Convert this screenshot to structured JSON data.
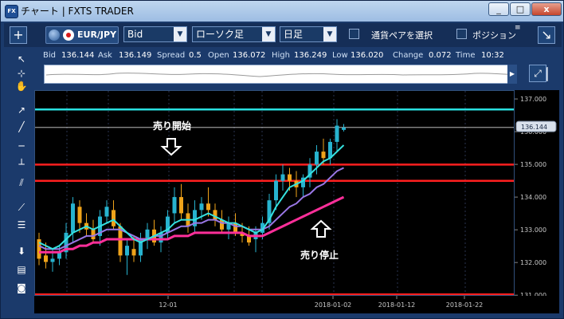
{
  "window": {
    "title": "チャート | FXTS TRADER",
    "app_icon": "FX",
    "controls": [
      "_",
      "□",
      "x"
    ]
  },
  "toolbar": {
    "add_label": "+",
    "symbol": "EUR/JPY",
    "price_type": "Bid",
    "chart_type": "ローソク足",
    "timeframe": "日足",
    "pair_select_label": "通貨ペアを選択",
    "position_label": "ポジション",
    "undock_label": "↘"
  },
  "info": {
    "bid_label": "Bid",
    "bid": "136.144",
    "ask_label": "Ask",
    "ask": "136.149",
    "spread_label": "Spread",
    "spread": "0.5",
    "open_label": "Open",
    "open": "136.072",
    "high_label": "High",
    "high": "136.249",
    "low_label": "Low",
    "low": "136.020",
    "change_label": "Change",
    "change": "0.072",
    "time_label": "Time",
    "time": "10:32"
  },
  "left_tools": [
    "cursor-icon",
    "crosshair-icon",
    "hand-icon",
    "trendline-tool-icon",
    "line-tool-icon",
    "hline-tool-icon",
    "vline-tool-icon",
    "channel-tool-icon",
    "fan-tool-icon",
    "fib-tool-icon",
    "download-icon",
    "list-icon",
    "camera-icon"
  ],
  "colors": {
    "background": "#000000",
    "panel": "#1b3a6b",
    "bull_candle": "#27b3cf",
    "bear_candle": "#f0a31a",
    "sl_line": "#ff1f1f",
    "level_line": "#29e0e0",
    "ma_fast": "#35e2e0",
    "ma_mid": "#9a77e6",
    "ma_slow": "#ff2f9a"
  },
  "annotations": {
    "sell_start": "売り開始",
    "sell_stop": "売り停止",
    "price_badge": "136.144"
  },
  "chart_data": {
    "type": "candlestick",
    "y_ticks": [
      "137.000",
      "136.000",
      "135.000",
      "134.000",
      "133.000",
      "132.000",
      "131.000"
    ],
    "x_ticks": [
      "12-01",
      "2018-01-02",
      "2018-01-12",
      "2018-01-22"
    ],
    "ylim": [
      131.0,
      137.0
    ],
    "horizontal_lines": [
      {
        "name": "cyan-level",
        "value": 136.7
      },
      {
        "name": "current-price",
        "value": 136.144
      },
      {
        "name": "red-level-1",
        "value": 135.0
      },
      {
        "name": "red-level-2",
        "value": 134.5
      },
      {
        "name": "red-level-3",
        "value": 131.0
      }
    ],
    "candles": [
      [
        132.7,
        132.9,
        131.9,
        132.1
      ],
      [
        132.2,
        132.6,
        131.8,
        132.0
      ],
      [
        132.0,
        132.4,
        131.7,
        132.1
      ],
      [
        132.1,
        132.5,
        131.9,
        132.3
      ],
      [
        132.3,
        133.2,
        132.1,
        132.9
      ],
      [
        132.9,
        134.0,
        132.6,
        133.8
      ],
      [
        133.7,
        133.9,
        132.9,
        133.2
      ],
      [
        133.2,
        133.5,
        132.8,
        133.0
      ],
      [
        133.0,
        133.3,
        132.6,
        132.7
      ],
      [
        132.8,
        133.6,
        132.5,
        133.4
      ],
      [
        133.4,
        133.9,
        133.2,
        133.7
      ],
      [
        133.6,
        133.9,
        133.0,
        133.1
      ],
      [
        133.1,
        133.2,
        132.0,
        132.2
      ],
      [
        132.2,
        132.7,
        131.6,
        132.5
      ],
      [
        132.4,
        132.8,
        132.0,
        132.2
      ],
      [
        132.2,
        132.9,
        132.0,
        132.7
      ],
      [
        132.7,
        133.2,
        132.4,
        133.0
      ],
      [
        133.0,
        133.3,
        132.5,
        132.6
      ],
      [
        132.6,
        133.1,
        132.3,
        132.9
      ],
      [
        132.9,
        133.6,
        132.7,
        133.4
      ],
      [
        133.5,
        134.3,
        133.2,
        134.0
      ],
      [
        134.0,
        134.4,
        133.3,
        133.5
      ],
      [
        133.5,
        133.8,
        132.9,
        133.1
      ],
      [
        133.1,
        133.9,
        132.9,
        133.6
      ],
      [
        133.6,
        134.0,
        133.3,
        133.8
      ],
      [
        133.8,
        134.3,
        133.4,
        133.6
      ],
      [
        133.6,
        133.8,
        133.1,
        133.3
      ],
      [
        133.3,
        133.6,
        132.9,
        133.0
      ],
      [
        133.0,
        133.4,
        132.7,
        133.2
      ],
      [
        133.2,
        133.5,
        132.8,
        132.9
      ],
      [
        132.9,
        133.2,
        132.6,
        132.8
      ],
      [
        132.8,
        133.1,
        132.5,
        132.6
      ],
      [
        132.7,
        133.1,
        132.3,
        132.9
      ],
      [
        132.9,
        133.4,
        132.7,
        133.2
      ],
      [
        133.2,
        134.1,
        133.0,
        133.9
      ],
      [
        133.9,
        134.7,
        133.6,
        134.5
      ],
      [
        134.5,
        135.0,
        134.2,
        134.7
      ],
      [
        134.7,
        134.9,
        134.2,
        134.5
      ],
      [
        134.5,
        134.8,
        134.0,
        134.3
      ],
      [
        134.3,
        134.7,
        134.0,
        134.6
      ],
      [
        134.6,
        135.2,
        134.3,
        135.0
      ],
      [
        135.0,
        135.6,
        134.7,
        135.4
      ],
      [
        135.4,
        135.8,
        135.0,
        135.2
      ],
      [
        135.2,
        135.8,
        135.0,
        135.7
      ],
      [
        135.7,
        136.4,
        135.4,
        136.2
      ],
      [
        136.07,
        136.25,
        136.02,
        136.14
      ]
    ],
    "ma_fast": [
      132.6,
      132.5,
      132.4,
      132.5,
      132.7,
      132.9,
      133.0,
      133.1,
      133.0,
      133.1,
      133.2,
      133.3,
      133.1,
      132.9,
      132.7,
      132.6,
      132.7,
      132.8,
      132.9,
      133.0,
      133.2,
      133.3,
      133.3,
      133.3,
      133.4,
      133.5,
      133.4,
      133.3,
      133.2,
      133.2,
      133.1,
      133.0,
      132.9,
      133.0,
      133.3,
      133.7,
      134.0,
      134.3,
      134.4,
      134.5,
      134.7,
      134.9,
      135.1,
      135.2,
      135.4,
      135.6
    ],
    "ma_mid": [
      132.5,
      132.4,
      132.4,
      132.4,
      132.5,
      132.6,
      132.7,
      132.8,
      132.8,
      132.9,
      133.0,
      133.0,
      133.0,
      132.9,
      132.8,
      132.7,
      132.7,
      132.8,
      132.8,
      132.9,
      133.0,
      133.1,
      133.1,
      133.2,
      133.2,
      133.3,
      133.3,
      133.2,
      133.2,
      133.1,
      133.1,
      133.0,
      133.0,
      133.0,
      133.1,
      133.3,
      133.5,
      133.7,
      133.8,
      134.0,
      134.1,
      134.3,
      134.4,
      134.6,
      134.8,
      134.9
    ],
    "ma_slow": [
      132.3,
      132.3,
      132.3,
      132.3,
      132.4,
      132.4,
      132.5,
      132.5,
      132.6,
      132.6,
      132.7,
      132.7,
      132.7,
      132.7,
      132.7,
      132.7,
      132.7,
      132.7,
      132.7,
      132.7,
      132.8,
      132.8,
      132.8,
      132.9,
      132.9,
      132.9,
      132.9,
      132.9,
      132.9,
      132.9,
      132.9,
      132.8,
      132.8,
      132.8,
      132.9,
      133.0,
      133.1,
      133.2,
      133.3,
      133.4,
      133.5,
      133.6,
      133.7,
      133.8,
      133.9,
      134.0
    ]
  }
}
